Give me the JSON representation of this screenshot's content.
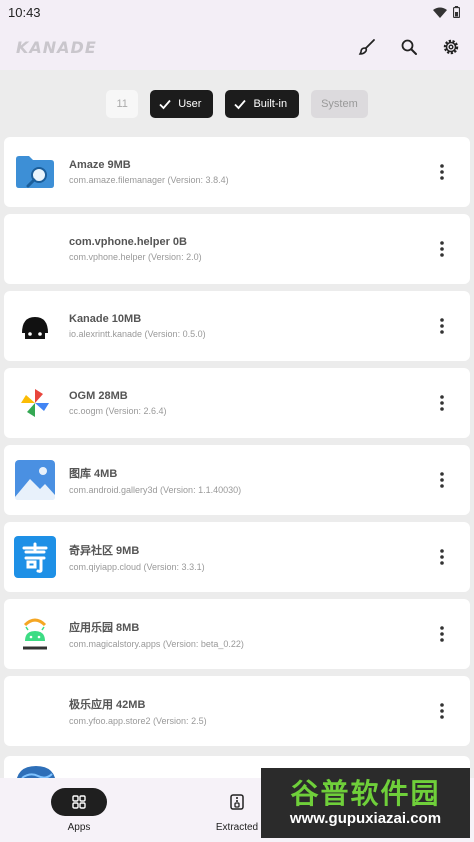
{
  "status_bar": {
    "time": "10:43"
  },
  "app_bar": {
    "logo": "KANADE"
  },
  "filters": {
    "count": "11",
    "user_label": "User",
    "builtin_label": "Built-in",
    "system_label": "System"
  },
  "apps": [
    {
      "title": "Amaze 9MB",
      "subtitle": "com.amaze.filemanager (Version: 3.8.4)",
      "icon": "folder-search-icon"
    },
    {
      "title": "com.vphone.helper 0B",
      "subtitle": "com.vphone.helper (Version: 2.0)",
      "icon": ""
    },
    {
      "title": "Kanade 10MB",
      "subtitle": "io.alexrintt.kanade (Version: 0.5.0)",
      "icon": "android-bot-icon"
    },
    {
      "title": "OGM 28MB",
      "subtitle": "cc.oogm (Version: 2.6.4)",
      "icon": "pinwheel-icon"
    },
    {
      "title": "图库 4MB",
      "subtitle": "com.android.gallery3d (Version: 1.1.40030)",
      "icon": "gallery-icon"
    },
    {
      "title": "奇异社区 9MB",
      "subtitle": "com.qiyiapp.cloud (Version: 3.3.1)",
      "icon": "qi-icon"
    },
    {
      "title": "应用乐园 8MB",
      "subtitle": "com.magicalstory.apps (Version: beta_0.22)",
      "icon": "android-logo-icon"
    },
    {
      "title": "极乐应用 42MB",
      "subtitle": "com.yfoo.app.store2 (Version: 2.5)",
      "icon": ""
    }
  ],
  "bottom_nav": {
    "apps_label": "Apps",
    "extracted_label": "Extracted"
  },
  "watermark": {
    "title": "谷普软件园",
    "url": "www.gupuxiazai.com"
  },
  "colors": {
    "accent": "#1c1c1c",
    "app_bar_bg": "#f3eef6",
    "page_bg": "#ececec"
  }
}
